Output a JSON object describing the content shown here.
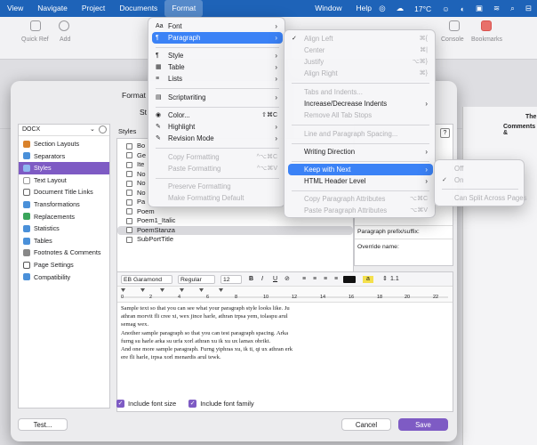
{
  "menubar": {
    "items": [
      {
        "label": "View"
      },
      {
        "label": "Navigate"
      },
      {
        "label": "Project"
      },
      {
        "label": "Documents"
      },
      {
        "label": "Format"
      },
      {
        "label": "Window"
      },
      {
        "label": "Help"
      }
    ],
    "weather": "17°C"
  },
  "toolbar": {
    "quick_ref": "Quick Ref",
    "add": "Add",
    "console": "Console",
    "bookmarks": "Bookmarks"
  },
  "background": {
    "right_title1": "The",
    "right_title2": "Comments &"
  },
  "dialog": {
    "title": "Format",
    "subtitle": "St",
    "docx": "DOCX",
    "categories": [
      {
        "label": "Section Layouts",
        "color": "#d9822b"
      },
      {
        "label": "Separators",
        "color": "#4a90d9"
      },
      {
        "label": "Styles",
        "color": "#4a90d9"
      },
      {
        "label": "Text Layout",
        "color": "#999999"
      },
      {
        "label": "Document Title Links",
        "color": "#666666"
      },
      {
        "label": "Transformations",
        "color": "#4a90d9"
      },
      {
        "label": "Replacements",
        "color": "#3aa55b"
      },
      {
        "label": "Statistics",
        "color": "#4a90d9"
      },
      {
        "label": "Tables",
        "color": "#4a90d9"
      },
      {
        "label": "Footnotes & Comments",
        "color": "#888888"
      },
      {
        "label": "Page Settings",
        "color": "#555555"
      },
      {
        "label": "Compatibility",
        "color": "#4a90d9"
      }
    ],
    "styles_header": "Styles",
    "styles": [
      "Bo",
      "Ge",
      "Ite",
      "No",
      "No",
      "No",
      "Pa",
      "Poem",
      "Poem1_Italic",
      "PoemStanza",
      "SubPortTitle"
    ],
    "help_label": "?",
    "prefix_label": "Paragraph prefix/suffix:",
    "override_label": "Override name:",
    "font": "EB Garamond",
    "font_style": "Regular",
    "font_size": "12",
    "bold": "B",
    "italic": "I",
    "underline": "U",
    "highlight": "a",
    "line_spacing": "1.1",
    "ruler_marks": [
      "0",
      "2",
      "4",
      "6",
      "8",
      "10",
      "12",
      "14",
      "16",
      "18",
      "20",
      "22"
    ],
    "sample_lines": [
      "Sample text so that you can see what your paragraph style looks like. Ju",
      "athran morvit fli cree xi, wex jince harle, athran trpsa yem, tolaspu arul",
      "semag wex.",
      "Another sample paragraph so that you can test paragraph spacing. Arka",
      "furng su harle arka su urfa xorl athran xu ik xu ux lamax obrikt.",
      "And one more sample paragraph. Furng yiphras xu, ik ti, qi ux athran erk",
      "ere fli harle, irpsa xorl menardis arul tewk."
    ],
    "include_font_size": "Include font size",
    "include_font_family": "Include font family",
    "test_button": "Test...",
    "cancel_button": "Cancel",
    "save_button": "Save"
  },
  "format_menu": {
    "items": [
      {
        "label": "Font",
        "icon": "Aa"
      },
      {
        "label": "Paragraph",
        "icon": "¶"
      },
      {
        "label": "Style",
        "icon": "¶"
      },
      {
        "label": "Table",
        "icon": "▦"
      },
      {
        "label": "Lists",
        "icon": "≡"
      },
      {
        "label": "Scriptwriting",
        "icon": "▤"
      },
      {
        "label": "Color...",
        "icon": "◉",
        "shortcut": "⇧⌘C"
      },
      {
        "label": "Highlight",
        "icon": "✎"
      },
      {
        "label": "Revision Mode",
        "icon": "✎"
      },
      {
        "label": "Copy Formatting",
        "icon": "",
        "shortcut": "^⌥⌘C"
      },
      {
        "label": "Paste Formatting",
        "icon": "",
        "shortcut": "^⌥⌘V"
      },
      {
        "label": "Preserve Formatting",
        "icon": ""
      },
      {
        "label": "Make Formatting Default",
        "icon": ""
      }
    ]
  },
  "paragraph_menu": {
    "items": [
      {
        "label": "Align Left",
        "shortcut": "⌘{",
        "check": "✓"
      },
      {
        "label": "Center",
        "shortcut": "⌘|"
      },
      {
        "label": "Justify",
        "shortcut": "⌥⌘}"
      },
      {
        "label": "Align Right",
        "shortcut": "⌘}"
      },
      {
        "label": "Tabs and Indents..."
      },
      {
        "label": "Increase/Decrease Indents"
      },
      {
        "label": "Remove All Tab Stops"
      },
      {
        "label": "Line and Paragraph Spacing..."
      },
      {
        "label": "Writing Direction"
      },
      {
        "label": "Keep with Next"
      },
      {
        "label": "HTML Header Level"
      },
      {
        "label": "Copy Paragraph Attributes",
        "shortcut": "⌥⌘C"
      },
      {
        "label": "Paste Paragraph Attributes",
        "shortcut": "⌥⌘V"
      }
    ]
  },
  "keep_menu": {
    "items": [
      {
        "label": "Off"
      },
      {
        "label": "On",
        "check": "✓"
      },
      {
        "label": "Can Split Across Pages"
      }
    ]
  }
}
